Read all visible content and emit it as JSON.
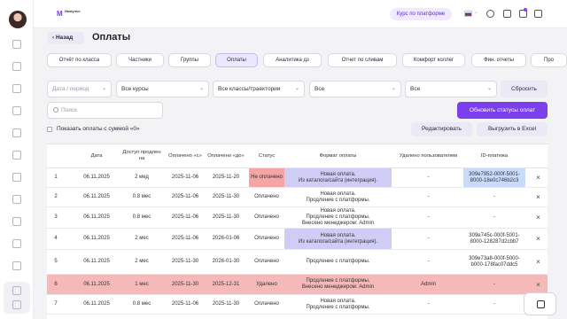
{
  "topbar": {
    "logo_text": "Импульс",
    "logo_sub": "Educational Platform",
    "course_button": "Курс по платформе",
    "language": "RU"
  },
  "header": {
    "back_label": "Назад",
    "title": "Оплаты"
  },
  "tabs": [
    {
      "label": "Отчёт по класса",
      "active": false
    },
    {
      "label": "Частники",
      "active": false
    },
    {
      "label": "Группы",
      "active": false
    },
    {
      "label": "Оплаты",
      "active": true
    },
    {
      "label": "Аналитика дз",
      "active": false
    },
    {
      "label": "Отчет по сливам",
      "active": false
    },
    {
      "label": "Комфорт коллег",
      "active": false
    },
    {
      "label": "Фин. отчеты",
      "active": false
    },
    {
      "label": "Про",
      "active": false
    }
  ],
  "filters": {
    "date_placeholder": "Дата / период",
    "courses": "Все курсы",
    "classes": "Все классы/траектории",
    "select3": "Все",
    "select4": "Все",
    "reset_label": "Сбросить",
    "search_placeholder": "Поиск",
    "update_label": "Обновить статусы оплат",
    "zero_checkbox_label": "Показать оплаты с суммой «0»",
    "edit_label": "Редактировать",
    "excel_label": "Выгрузить в Excel"
  },
  "table": {
    "columns": [
      "",
      "",
      "Дата",
      "Доступ продлен на",
      "Оплачено «с»",
      "Оплачено «до»",
      "Статус",
      "Формат оплаты",
      "Удалено пользователем",
      "ID-платежа",
      ""
    ],
    "rows": [
      {
        "n": "1",
        "date": "06.11.2025",
        "ext": "2 мед",
        "from": "2025-11-06",
        "to": "2025-11-20",
        "status": "Не оплачено",
        "status_red": true,
        "format": "Новая оплата.\nИз каталога/сайта (интеграция).",
        "format_style": "purple",
        "deleted": "-",
        "id": "309e7952-000f-5001-8000-18e0c746b2c3",
        "id_style": "blue",
        "highlight": false
      },
      {
        "n": "2",
        "date": "06.11.2025",
        "ext": "0.8 мес",
        "from": "2025-11-06",
        "to": "2025-11-30",
        "status": "Оплачено",
        "status_red": false,
        "format": "Новая оплата.\nПродление с платформы.",
        "format_style": "",
        "deleted": "-",
        "id": "-",
        "id_style": "",
        "highlight": false
      },
      {
        "n": "3",
        "date": "06.11.2025",
        "ext": "0.8 мес",
        "from": "2025-11-06",
        "to": "2025-11-30",
        "status": "Оплачено",
        "status_red": false,
        "format": "Новая оплата.\nПродление с платформы.\nВнесено менеджером: Admin",
        "format_style": "",
        "deleted": "-",
        "id": "-",
        "id_style": "",
        "highlight": false
      },
      {
        "n": "4",
        "date": "06.11.2025",
        "ext": "2 мес",
        "from": "2025-11-06",
        "to": "2026-01-06",
        "status": "Оплачено",
        "status_red": false,
        "format": "Новая оплата.\nИз каталога/сайта (интеграция).",
        "format_style": "purple",
        "deleted": "-",
        "id": "309e745c-000f-5001-8000-128287d2cbb7",
        "id_style": "",
        "highlight": false
      },
      {
        "n": "5",
        "date": "06.11.2025",
        "ext": "2 мес",
        "from": "2025-11-30",
        "to": "2026-01-30",
        "status": "Оплачено",
        "status_red": false,
        "format": "Продление с платформы.",
        "format_style": "",
        "deleted": "-",
        "id": "309e73a8-000f-5000-b000-178fac07ddc5",
        "id_style": "",
        "highlight": false
      },
      {
        "n": "6",
        "date": "06.11.2025",
        "ext": "1 мес",
        "from": "2025-11-30",
        "to": "2025-12-31",
        "status": "Удалено",
        "status_red": false,
        "format": "Продление с платформы.\nВнесено менеджером: Admin",
        "format_style": "",
        "deleted": "Admin",
        "id": "-",
        "id_style": "",
        "highlight": true
      },
      {
        "n": "7",
        "date": "06.11.2025",
        "ext": "0.8 мес",
        "from": "2025-11-06",
        "to": "2025-11-30",
        "status": "Оплачено",
        "status_red": false,
        "format": "Новая оплата.\nПродление с платформы.",
        "format_style": "",
        "deleted": "-",
        "id": "-",
        "id_style": "",
        "highlight": false
      }
    ],
    "delete_symbol": "×"
  },
  "colors": {
    "accent": "#7b3fee",
    "tab_active": "#ede6ff",
    "row_highlight": "#f6b9b9",
    "status_red": "#f6a4a4"
  },
  "icons": [
    "users-icon",
    "calendar-check-icon",
    "bell-icon",
    "logout-icon",
    "chat-icon"
  ]
}
